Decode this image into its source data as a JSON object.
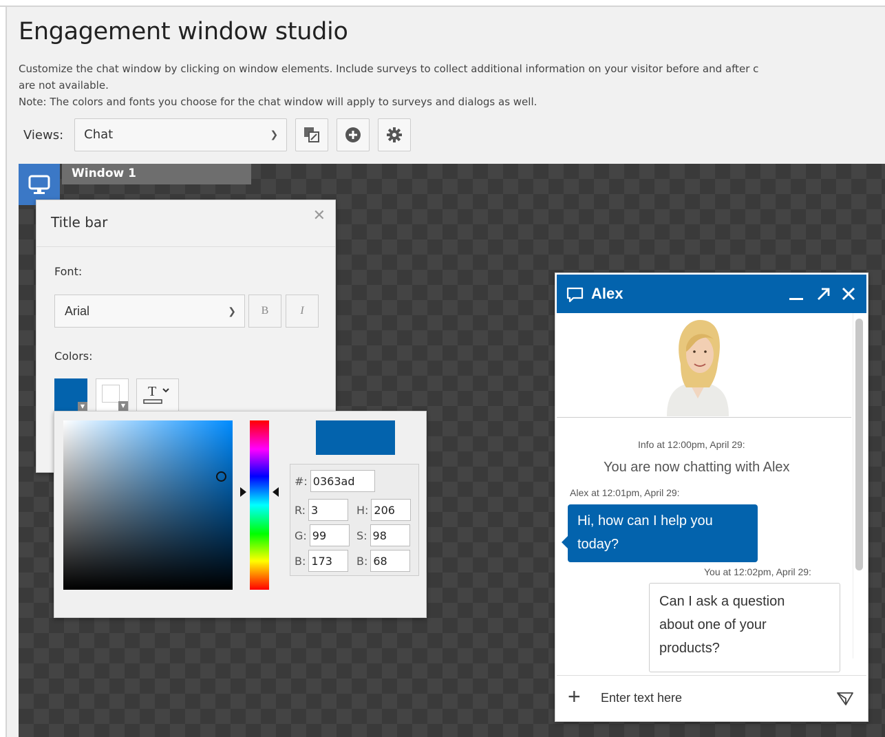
{
  "page": {
    "title": "Engagement window studio",
    "desc_line1": "Customize the chat window by clicking on window elements. Include surveys to collect additional information on your visitor before and after c",
    "desc_line2": "are not available.",
    "desc_line3": "Note: The colors and fonts you choose for the chat window will apply to surveys and dialogs as well."
  },
  "views": {
    "label": "Views:",
    "selected": "Chat",
    "tools": [
      "copy-view-icon",
      "add-view-icon",
      "settings-icon"
    ]
  },
  "canvas": {
    "window_tab": "Window 1"
  },
  "title_bar_panel": {
    "heading": "Title bar",
    "font_label": "Font:",
    "font_value": "Arial",
    "bold_label": "B",
    "italic_label": "I",
    "colors_label": "Colors:",
    "background_color": "#0363ad",
    "text_color": "#ffffff"
  },
  "color_picker": {
    "hex_label": "#:",
    "hex": "0363ad",
    "r_label": "R:",
    "r": "3",
    "g_label": "G:",
    "g": "99",
    "b_label": "B:",
    "b": "173",
    "h_label": "H:",
    "h": "206",
    "s_label": "S:",
    "s": "98",
    "v_label": "B:",
    "v": "68"
  },
  "chat_preview": {
    "agent_name": "Alex",
    "info_meta": "Info at 12:00pm, April 29:",
    "system_message": "You are now chatting with Alex",
    "agent_meta": "Alex at 12:01pm, April 29:",
    "agent_msg_line1": "Hi, how can I help you",
    "agent_msg_line2": "today?",
    "user_meta": "You at 12:02pm, April 29:",
    "user_msg_line1": "Can I ask a question",
    "user_msg_line2": "about one of your",
    "user_msg_line3": "products?",
    "input_placeholder": "Enter text here",
    "accent_color": "#0363ad"
  }
}
